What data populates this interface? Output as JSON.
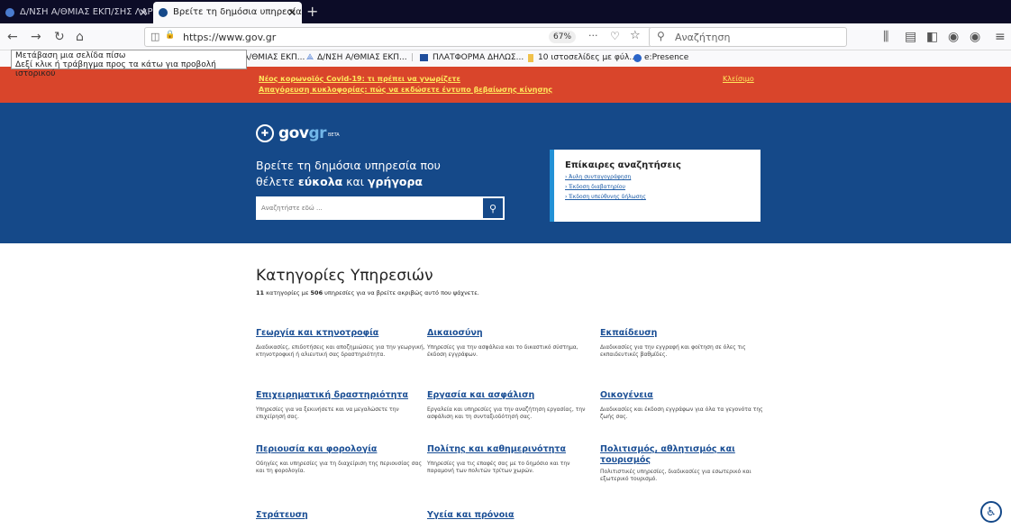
{
  "browser": {
    "tabs": [
      {
        "title": "Δ/ΝΣΗ Α/ΘΜΙΑΣ ΕΚΠ/ΣΗΣ ΛΑΡ",
        "active": false
      },
      {
        "title": "Βρείτε τη δημόσια υπηρεσία π",
        "active": true
      }
    ],
    "new_tab": "+",
    "url": "https://www.gov.gr",
    "zoom": "67%",
    "search_placeholder": "Αναζήτηση",
    "tooltip_line1": "Μετάβαση μια σελίδα πίσω",
    "tooltip_line2": "Δεξί κλικ ή τράβηγμα προς τα κάτω για προβολή ιστορικού",
    "bookmarks": [
      {
        "label": "Α/ΘΜΙΑΣ ΕΚΠ..."
      },
      {
        "label": "Δ/ΝΣΗ Α/ΘΜΙΑΣ ΕΚΠ..."
      },
      {
        "label": "ΠΛΑΤΦΟΡΜΑ ΔΗΛΩΣ..."
      },
      {
        "label": "10 ιστοσελίδες με φύλ..."
      },
      {
        "label": "e:Presence"
      }
    ]
  },
  "banner": {
    "link1": "Νέος κορωνοϊός Covid-19: τι πρέπει να γνωρίζετε",
    "link2": "Απαγόρευση κυκλοφορίας: πώς να εκδώσετε έντυπο βεβαίωσης κίνησης",
    "close": "Κλείσιμο"
  },
  "hero": {
    "logo_main": "gov",
    "logo_gr": "gr",
    "logo_beta": "BETA",
    "line1": "Βρείτε τη δημόσια υπηρεσία που",
    "line2_a": "θέλετε ",
    "line2_b": "εύκολα",
    "line2_c": " και ",
    "line2_d": "γρήγορα",
    "search_placeholder": "Αναζητήστε εδώ ...",
    "trending_title": "Επίκαιρες αναζητήσεις",
    "trending": [
      "› Άυλη συνταγογράφηση",
      "› Έκδοση διαβατηρίου",
      "› Έκδοση υπεύθυνης δήλωσης"
    ]
  },
  "categories": {
    "title": "Κατηγορίες Υπηρεσιών",
    "count": "11",
    "subtitle_mid": " κατηγορίες με ",
    "services": "506",
    "subtitle_end": " υπηρεσίες για να βρείτε ακριβώς αυτό που ψάχνετε.",
    "items": [
      {
        "name": "Γεωργία και κτηνοτροφία",
        "desc": "Διαδικασίες, επιδοτήσεις και αποζημιώσεις για την γεωργική, κτηνοτροφική ή αλιευτική σας δραστηριότητα."
      },
      {
        "name": "Δικαιοσύνη",
        "desc": "Υπηρεσίες για την ασφάλεια και το δικαστικό σύστημα, έκδοση εγγράφων."
      },
      {
        "name": "Εκπαίδευση",
        "desc": "Διαδικασίες για την εγγραφή και φοίτηση σε όλες τις εκπαιδευτικές βαθμίδες."
      },
      {
        "name": "Επιχειρηματική δραστηριότητα",
        "desc": "Υπηρεσίες για να ξεκινήσετε και να μεγαλώσετε την επιχείρησή σας."
      },
      {
        "name": "Εργασία και ασφάλιση",
        "desc": "Εργαλεία και υπηρεσίες για την αναζήτηση εργασίας, την ασφάλιση και τη συνταξιοδότησή σας."
      },
      {
        "name": "Οικογένεια",
        "desc": "Διαδικασίες και έκδοση εγγράφων για όλα τα γεγονότα της ζωής σας."
      },
      {
        "name": "Περιουσία και φορολογία",
        "desc": "Οδηγίες και υπηρεσίες για τη διαχείριση της περιουσίας σας και τη φορολογία."
      },
      {
        "name": "Πολίτης και καθημερινότητα",
        "desc": "Υπηρεσίες για τις επαφές σας με το δημόσιο και την παραμονή των πολιτών τρίτων χωρών."
      },
      {
        "name": "Πολιτισμός, αθλητισμός και τουρισμός",
        "desc": "Πολιτιστικές υπηρεσίες, διαδικασίες για εσωτερικό και εξωτερικό τουρισμό."
      },
      {
        "name": "Στράτευση",
        "desc": ""
      },
      {
        "name": "Υγεία και πρόνοια",
        "desc": ""
      }
    ]
  },
  "icons": {
    "back": "←",
    "forward": "→",
    "reload": "↻",
    "home": "⌂",
    "shield": "◫",
    "lock": "🔒",
    "more": "···",
    "pocket": "♡",
    "star": "☆",
    "search": "⚲",
    "library": "⫼",
    "reader": "▤",
    "sidebar": "◧",
    "account": "◉",
    "menu": "≡",
    "accessibility": "♿"
  }
}
